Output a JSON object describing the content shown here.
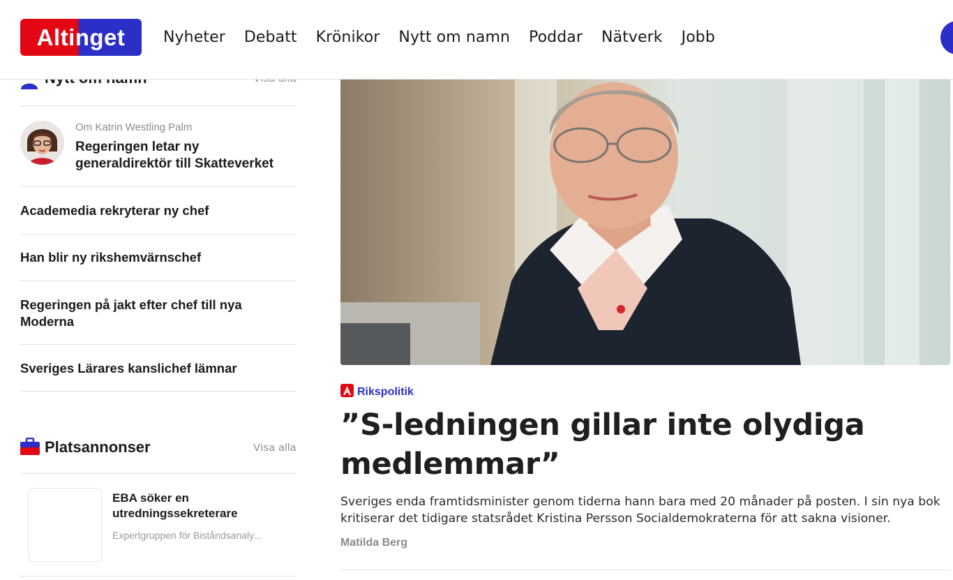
{
  "header": {
    "logo_text": "Altinget",
    "nav": [
      "Nyheter",
      "Debatt",
      "Krönikor",
      "Nytt om namn",
      "Poddar",
      "Nätverk",
      "Jobb"
    ]
  },
  "sidebar": {
    "nytt_om_namn": {
      "title": "Nytt om namn",
      "visa_alla": "Visa alla",
      "featured": {
        "meta": "Om Katrin Westling Palm",
        "title": "Regeringen letar ny generaldirektör till Skatteverket"
      },
      "items": [
        "Academedia rekryterar ny chef",
        "Han blir ny rikshemvärnschef",
        "Regeringen på jakt efter chef till nya Moderna",
        "Sveriges Lärares kanslichef lämnar"
      ]
    },
    "platsannonser": {
      "title": "Platsannonser",
      "visa_alla": "Visa alla",
      "job": {
        "title": "EBA söker en utredningssekreterare",
        "company": "Expertgruppen för Biståndsanaly..."
      }
    }
  },
  "article": {
    "category": "Rikspolitik",
    "headline": "”S-ledningen gillar inte olydiga medlemmar”",
    "lead": "Sveriges enda framtidsminister genom tiderna hann bara med 20 månader på posten. I sin nya bok kritiserar det tidigare statsrådet Kristina Persson Socialdemokraterna för att sakna visioner.",
    "byline": "Matilda Berg"
  },
  "colors": {
    "brand_red": "#e30613",
    "brand_blue": "#2b2fc8",
    "text": "#1a1a1a",
    "muted": "#888888"
  }
}
